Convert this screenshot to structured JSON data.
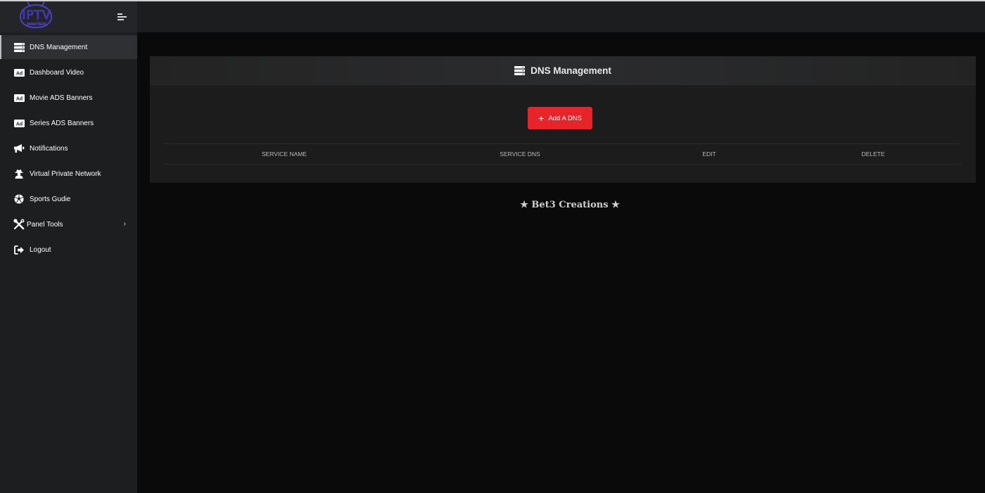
{
  "brand": {
    "logo_text": "IPTV",
    "logo_subtext": "SMARTERS"
  },
  "sidebar": {
    "items": [
      {
        "label": "DNS Management",
        "icon": "server-icon",
        "active": true
      },
      {
        "label": "Dashboard Video",
        "icon": "ad-icon"
      },
      {
        "label": "Movie ADS Banners",
        "icon": "ad-icon"
      },
      {
        "label": "Series ADS Banners",
        "icon": "ad-icon"
      },
      {
        "label": "Notifications",
        "icon": "megaphone-icon"
      },
      {
        "label": "Virtual Private Network",
        "icon": "user-secret-icon"
      },
      {
        "label": "Sports Gudie",
        "icon": "futbol-icon"
      },
      {
        "label": "Panel Tools",
        "icon": "tools-icon",
        "has_submenu": true
      },
      {
        "label": "Logout",
        "icon": "sign-out-icon"
      }
    ]
  },
  "card": {
    "title": "DNS Management",
    "add_button_label": "Add A DNS",
    "columns": [
      "SERVICE NAME",
      "SERVICE DNS",
      "EDIT",
      "DELETE"
    ],
    "rows": []
  },
  "footer": {
    "credit": "★ Bet3 Creations ★"
  },
  "colors": {
    "accent": "#e6242a",
    "sidebar_bg": "#1d1e20",
    "page_bg": "#0a0a0a",
    "logo": "#4b3fc8"
  }
}
